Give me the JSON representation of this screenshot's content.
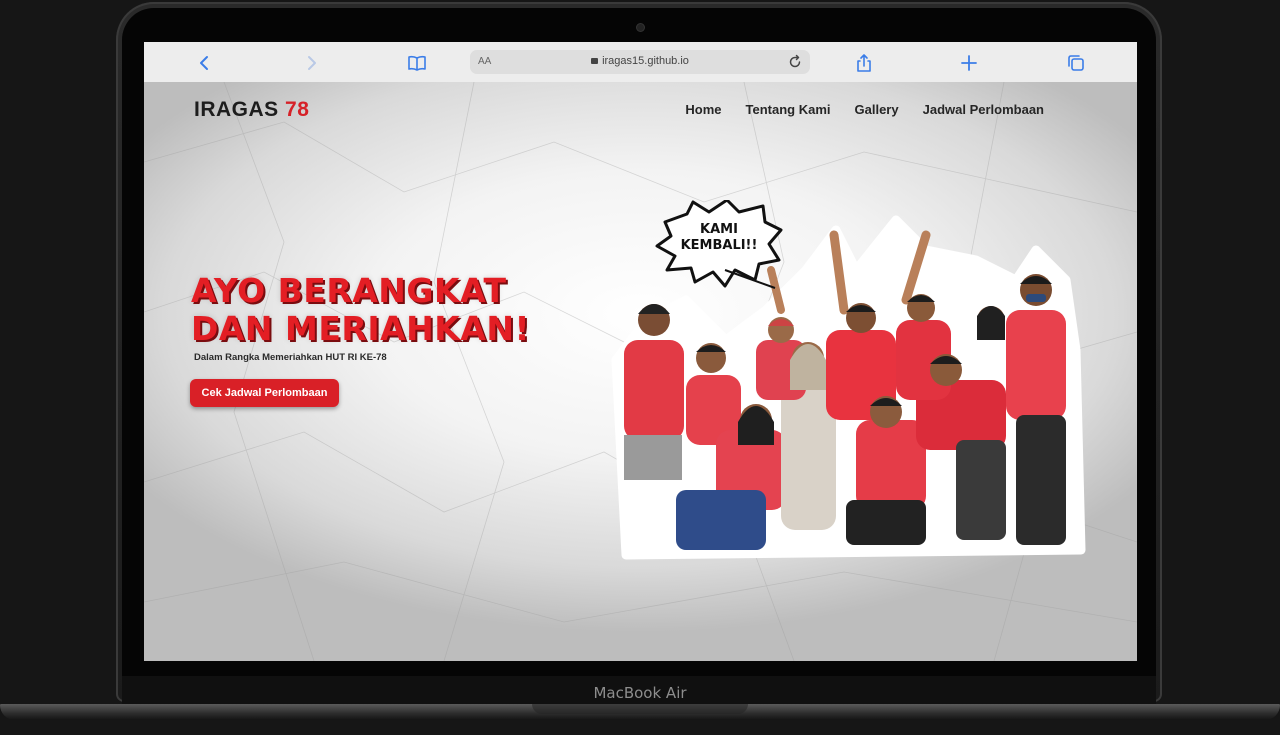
{
  "device": {
    "label": "MacBook Air"
  },
  "browser": {
    "text_size_label": "AA",
    "url": "iragas15.github.io"
  },
  "site": {
    "logo_text": "IRAGAS",
    "logo_number": "78",
    "nav": [
      "Home",
      "Tentang Kami",
      "Gallery",
      "Jadwal Perlombaan"
    ],
    "headline_line1": "AYO BERANGKAT",
    "headline_line2": "DAN MERIAHKAN!",
    "subtitle": "Dalam Rangka Memeriahkan HUT RI KE-78",
    "cta_label": "Cek Jadwal Perlombaan",
    "speech_bubble_line1": "KAMI",
    "speech_bubble_line2": "KEMBALI!!",
    "accent_color": "#d62128"
  }
}
